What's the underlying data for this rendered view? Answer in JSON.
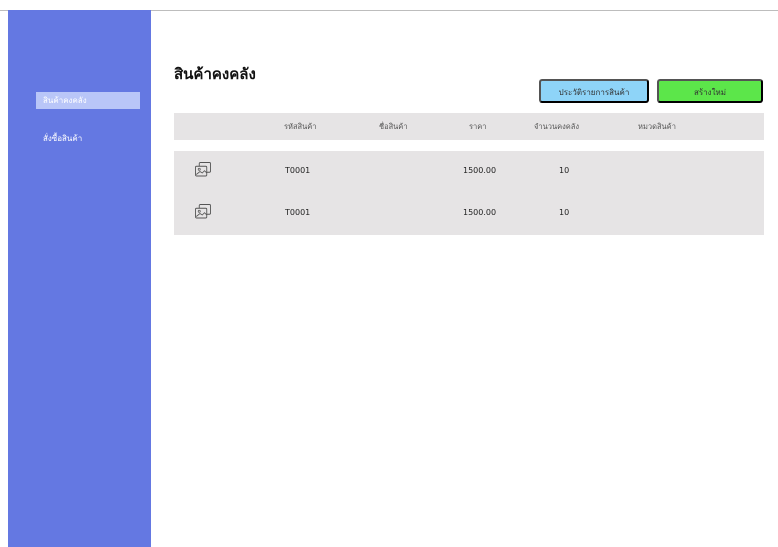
{
  "sidebar": {
    "items": [
      {
        "label": "สินค้าคงคลัง",
        "active": true
      },
      {
        "label": "สั่งซื้อสินค้า",
        "active": false
      }
    ]
  },
  "page": {
    "title": "สินค้าคงคลัง"
  },
  "actions": {
    "history_label": "ประวัติรายการสินค้า",
    "create_label": "สร้างใหม่"
  },
  "table": {
    "columns": [
      "รหัสสินค้า",
      "ชื่อสินค้า",
      "ราคา",
      "จำนวนคงคลัง",
      "หมวดสินค้า"
    ],
    "rows": [
      {
        "image_icon": "image-icon",
        "code": "T0001",
        "name": "",
        "price": "1500.00",
        "stock": "10",
        "category": ""
      },
      {
        "image_icon": "image-icon",
        "code": "T0001",
        "name": "",
        "price": "1500.00",
        "stock": "10",
        "category": ""
      }
    ]
  },
  "colors": {
    "sidebar": "#6478e2",
    "sidebar_active": "#b9c6f8",
    "history_button": "#8ed4f8",
    "create_button": "#5ce64a",
    "table_bg": "#e6e4e5"
  }
}
